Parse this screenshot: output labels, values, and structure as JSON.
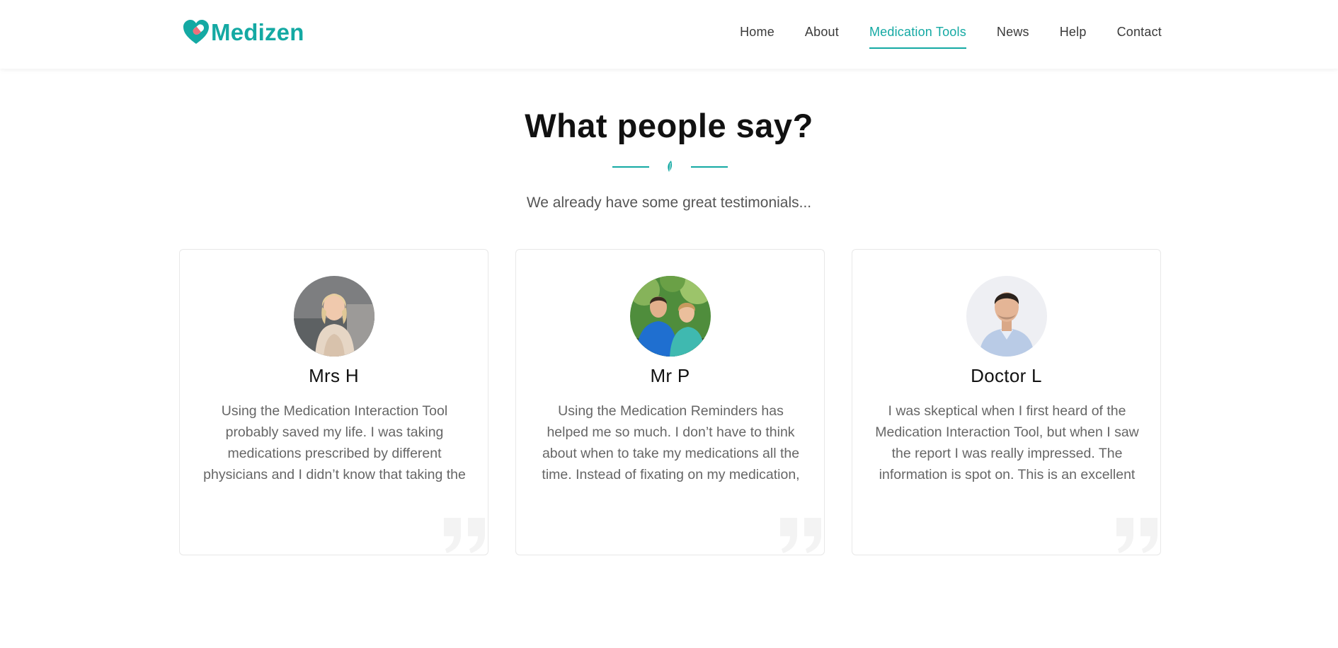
{
  "header": {
    "logo_text": "Medizen",
    "logo_icon": "heart-pill-icon",
    "nav": [
      {
        "label": "Home",
        "active": false
      },
      {
        "label": "About",
        "active": false
      },
      {
        "label": "Medication Tools",
        "active": true
      },
      {
        "label": "News",
        "active": false
      },
      {
        "label": "Help",
        "active": false
      },
      {
        "label": "Contact",
        "active": false
      }
    ]
  },
  "section": {
    "title": "What people say?",
    "subtitle": "We already have some great testimonials...",
    "divider_icon": "leaf-icon"
  },
  "testimonials": [
    {
      "name": "Mrs H",
      "text": "Using the Medication Interaction Tool probably saved my life. I was taking medications prescribed by different physicians and I didn’t know that taking the pills together was the same as tripling up on the dose."
    },
    {
      "name": "Mr P",
      "text": "Using the Medication Reminders has helped me so much. I don’t have to think about when to take my medications all the time. Instead of fixating on my medication, I can focus on work and fun activities, like cycling."
    },
    {
      "name": "Doctor L",
      "text": "I was skeptical when I first heard of the Medication Interaction Tool, but when I saw the report I was really impressed. The information is spot on. This is an excellent tool for people to use at home."
    }
  ],
  "colors": {
    "accent": "#14a9a3",
    "heading": "#111111",
    "body_text": "#666666",
    "card_border": "#e8e8e8"
  }
}
